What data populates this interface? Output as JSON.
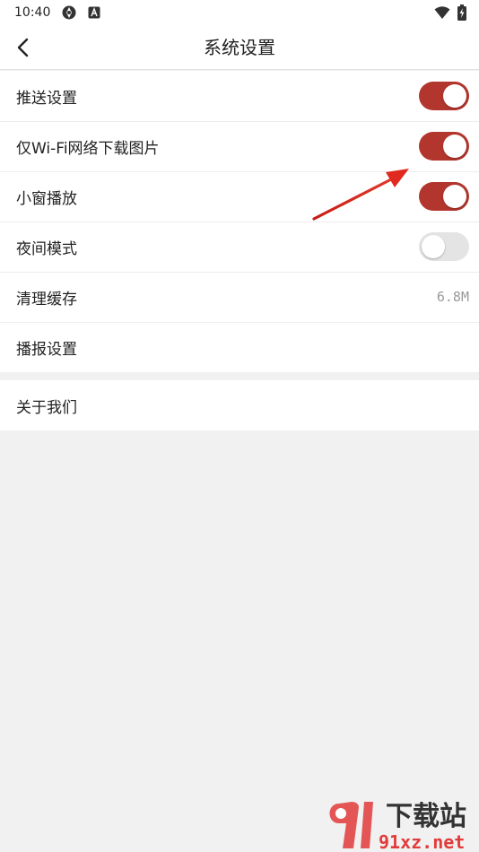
{
  "status_bar": {
    "time": "10:40"
  },
  "header": {
    "title": "系统设置"
  },
  "settings": [
    {
      "label": "推送设置",
      "control": "toggle",
      "on": true
    },
    {
      "label": "仅Wi-Fi网络下载图片",
      "control": "toggle",
      "on": true
    },
    {
      "label": "小窗播放",
      "control": "toggle",
      "on": true
    },
    {
      "label": "夜间模式",
      "control": "toggle",
      "on": false
    },
    {
      "label": "清理缓存",
      "control": "value",
      "value": "6.8M"
    },
    {
      "label": "播报设置",
      "control": "none"
    }
  ],
  "about": {
    "label": "关于我们"
  },
  "colors": {
    "accent": "#b3362e",
    "toggle_off": "#e4e4e4",
    "background": "#f1f1f1",
    "arrow": "#d92a1f"
  },
  "watermark": {
    "logo_text": "下载站",
    "domain": "91xz.net"
  }
}
